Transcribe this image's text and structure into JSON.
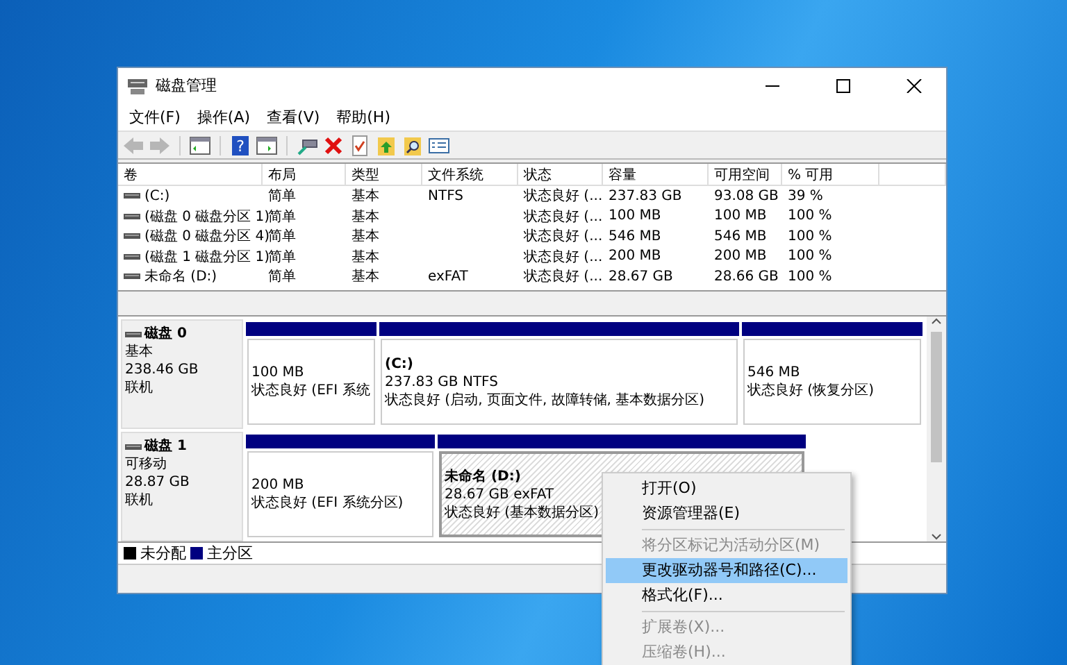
{
  "window": {
    "title": "磁盘管理"
  },
  "menu_bar": [
    "文件(F)",
    "操作(A)",
    "查看(V)",
    "帮助(H)"
  ],
  "toolbar": [
    {
      "kind": "back",
      "disabled": true
    },
    {
      "kind": "forward",
      "disabled": true
    },
    {
      "kind": "panel",
      "disabled": false
    },
    {
      "kind": "help",
      "disabled": false,
      "glyph": "?"
    },
    {
      "kind": "panel2",
      "disabled": false
    },
    {
      "kind": "connect",
      "disabled": false
    },
    {
      "kind": "delete",
      "disabled": false
    },
    {
      "kind": "check",
      "disabled": false
    },
    {
      "kind": "folderup",
      "disabled": false
    },
    {
      "kind": "foldersearch",
      "disabled": false
    },
    {
      "kind": "list",
      "disabled": false
    }
  ],
  "volume_table": {
    "columns": [
      "卷",
      "布局",
      "类型",
      "文件系统",
      "状态",
      "容量",
      "可用空间",
      "% 可用"
    ],
    "rows": [
      [
        "(C:)",
        "简单",
        "基本",
        "NTFS",
        "状态良好 (...",
        "237.83 GB",
        "93.08 GB",
        "39 %"
      ],
      [
        "(磁盘 0 磁盘分区 1)",
        "简单",
        "基本",
        "",
        "状态良好 (...",
        "100 MB",
        "100 MB",
        "100 %"
      ],
      [
        "(磁盘 0 磁盘分区 4)",
        "简单",
        "基本",
        "",
        "状态良好 (...",
        "546 MB",
        "546 MB",
        "100 %"
      ],
      [
        "(磁盘 1 磁盘分区 1)",
        "简单",
        "基本",
        "",
        "状态良好 (...",
        "200 MB",
        "200 MB",
        "100 %"
      ],
      [
        "未命名 (D:)",
        "简单",
        "基本",
        "exFAT",
        "状态良好 (...",
        "28.67 GB",
        "28.66 GB",
        "100 %"
      ]
    ]
  },
  "disks": [
    {
      "name": "磁盘 0",
      "type": "基本",
      "size": "238.46 GB",
      "status": "联机",
      "partitions": [
        {
          "size": "100 MB",
          "status": "状态良好 (EFI 系统",
          "selected": false
        },
        {
          "label": "(C:)",
          "size": "237.83 GB NTFS",
          "status": "状态良好 (启动, 页面文件, 故障转储, 基本数据分区)",
          "selected": false
        },
        {
          "size": "546 MB",
          "status": "状态良好 (恢复分区)",
          "selected": false
        }
      ]
    },
    {
      "name": "磁盘 1",
      "type": "可移动",
      "size": "28.87 GB",
      "status": "联机",
      "partitions": [
        {
          "size": "200 MB",
          "status": "状态良好 (EFI 系统分区)",
          "selected": false
        },
        {
          "label": "未命名  (D:)",
          "size": "28.67 GB exFAT",
          "status": "状态良好 (基本数据分区)",
          "selected": true
        }
      ]
    }
  ],
  "legend": [
    {
      "label": "未分配",
      "color": "#000000"
    },
    {
      "label": "主分区",
      "color": "#000080"
    }
  ],
  "context_menu": [
    {
      "kind": "item",
      "label": "打开(O)",
      "disabled": false,
      "selected": false
    },
    {
      "kind": "item",
      "label": "资源管理器(E)",
      "disabled": false,
      "selected": false
    },
    {
      "kind": "separator"
    },
    {
      "kind": "item",
      "label": "将分区标记为活动分区(M)",
      "disabled": true,
      "selected": false
    },
    {
      "kind": "item",
      "label": "更改驱动器号和路径(C)...",
      "disabled": false,
      "selected": true
    },
    {
      "kind": "item",
      "label": "格式化(F)...",
      "disabled": false,
      "selected": false
    },
    {
      "kind": "separator"
    },
    {
      "kind": "item",
      "label": "扩展卷(X)...",
      "disabled": true,
      "selected": false
    },
    {
      "kind": "item",
      "label": "压缩卷(H)...",
      "disabled": true,
      "selected": false
    }
  ]
}
